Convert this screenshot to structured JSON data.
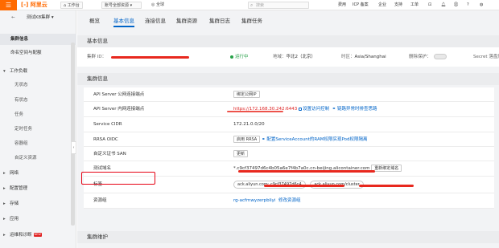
{
  "topbar": {
    "menu_icon": "☰",
    "logo": "[-] 阿里云",
    "workspace_label": "工作台",
    "resource_selector": "账号全部资源",
    "region_label": "全球",
    "search_placeholder": "搜索",
    "links": [
      "费用",
      "ICP 备案",
      "企业",
      "支持",
      "工单"
    ]
  },
  "sidebar": {
    "cluster_name": "测试K8集群",
    "items": [
      {
        "label": "集群信息",
        "active": true
      },
      {
        "label": "命名空间与配额"
      },
      {
        "label": "工作负载",
        "group": true,
        "expanded": true
      },
      {
        "label": "无状态"
      },
      {
        "label": "有状态"
      },
      {
        "label": "任务"
      },
      {
        "label": "定时任务"
      },
      {
        "label": "容器组"
      },
      {
        "label": "自定义资源"
      },
      {
        "label": "网络",
        "group": true
      },
      {
        "label": "配置管理",
        "group": true
      },
      {
        "label": "存储",
        "group": true
      },
      {
        "label": "应用",
        "group": true
      },
      {
        "label": "运维和诊断",
        "group": true,
        "badge": "NEW"
      }
    ],
    "collapse_icon": "‹"
  },
  "tabs": [
    "概览",
    "基本信息",
    "连接信息",
    "集群资源",
    "集群日志",
    "集群任务"
  ],
  "active_tab": 1,
  "basic_section": {
    "title": "基本信息",
    "cluster_id_label": "集群 ID：",
    "status": "运行中",
    "region_label": "地域：",
    "region_value": "华北2（北京）",
    "timezone_label": "时区：",
    "timezone_value": "Asia/Shanghai",
    "deletion_protect_label": "删除保护：",
    "secret_label": "Secret 落盘加"
  },
  "cluster_section": {
    "title": "集群信息",
    "rows": {
      "public_endpoint": {
        "label": "API Server 公网连接端点",
        "button": "绑定公网IP"
      },
      "private_endpoint": {
        "label": "API Server 内网连接端点",
        "value": "https://172.168.30.242:6443",
        "link1": "设置访问控制",
        "link2": "链路异常时排查思路"
      },
      "service_cidr": {
        "label": "Service CIDR",
        "value": "172.21.0.0/20"
      },
      "rrsa": {
        "label": "RRSA OIDC",
        "button": "启用 RRSA",
        "link": "配置ServiceAccount的RAM权限实现Pod权限隔离"
      },
      "custom_san": {
        "label": "自定义证书 SAN",
        "button": "更新"
      },
      "test_domain": {
        "label": "测试域名",
        "value": "*.c9cf37497d6c4b05a6e7f4b7a0c.cn-beijing.alicontainer.com",
        "button": "重新绑定域名"
      },
      "tags": {
        "label": "标签",
        "chip1": "ack.aliyun.com: c9cf37497d6c4",
        "chip2": "ack.aliyun.com/cluster"
      },
      "resource_group": {
        "label": "资源组",
        "value": "rg-acfmwyzerpbliyi",
        "link": "修改资源组"
      }
    }
  },
  "maintenance_section": {
    "title": "集群维护"
  },
  "colors": {
    "accent": "#0064c8",
    "brand": "#ff6a00",
    "running": "#26a148",
    "highlight": "#e60012"
  }
}
